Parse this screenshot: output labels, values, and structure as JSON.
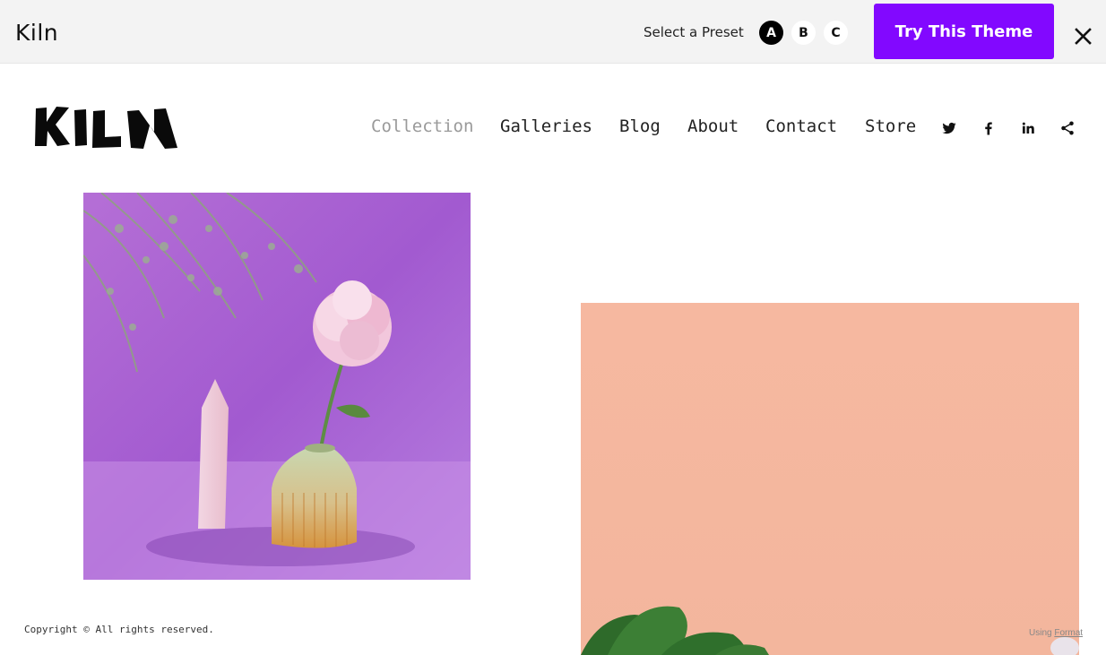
{
  "preview_bar": {
    "theme_name": "Kiln",
    "preset_label": "Select a Preset",
    "presets": [
      "A",
      "B",
      "C"
    ],
    "selected_preset": "A",
    "cta_label": "Try This Theme",
    "accent_color": "#8208ff"
  },
  "site": {
    "logo_text": "KILN",
    "nav": [
      {
        "label": "Collection",
        "active": true
      },
      {
        "label": "Galleries",
        "active": false
      },
      {
        "label": "Blog",
        "active": false
      },
      {
        "label": "About",
        "active": false
      },
      {
        "label": "Contact",
        "active": false
      },
      {
        "label": "Store",
        "active": false
      }
    ],
    "social_icons": [
      "twitter-icon",
      "facebook-icon",
      "linkedin-icon",
      "share-icon"
    ]
  },
  "gallery": {
    "images": [
      "purple-vase-peony-photo",
      "peach-background-plant-photo"
    ]
  },
  "footer": {
    "copyright": "Copyright © All rights reserved.",
    "using_prefix": "Using",
    "platform_link": "Format"
  }
}
